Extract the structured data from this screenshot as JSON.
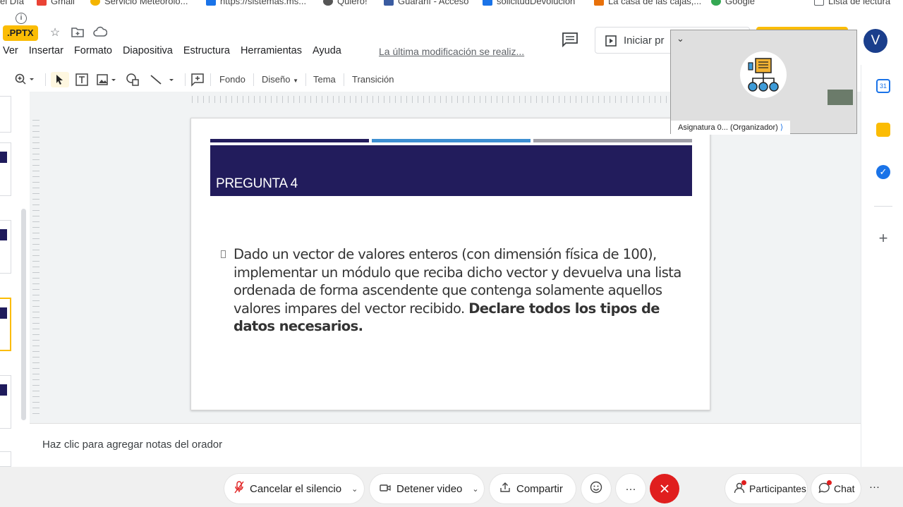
{
  "bookmarks": [
    {
      "label": "el Día",
      "color": "#ffffff"
    },
    {
      "label": "Gmail",
      "color": "#ea4335"
    },
    {
      "label": "Servicio Meteorolo...",
      "color": "#f4b400"
    },
    {
      "label": "https://sistemas.ms...",
      "color": "#1a73e8"
    },
    {
      "label": "Quiero!",
      "color": "#555555"
    },
    {
      "label": "Guaraní - Acceso",
      "color": "#3a5ba0"
    },
    {
      "label": "solicitudDevolucion",
      "color": "#1a73e8"
    },
    {
      "label": "La casa de las cajas,...",
      "color": "#e8710a"
    },
    {
      "label": "Google",
      "color": "#34a853"
    },
    {
      "label": "Lista de lectura",
      "color": "#5f6368"
    }
  ],
  "doc": {
    "file_badge": ".PPTX",
    "star_icon": "star-icon",
    "move_icon": "folder-move-icon",
    "cloud_icon": "cloud-status-icon",
    "last_edit": "La última modificación se realiz..."
  },
  "menu": [
    "Ver",
    "Insertar",
    "Formato",
    "Diapositiva",
    "Estructura",
    "Herramientas",
    "Ayuda"
  ],
  "header": {
    "present_label": "Iniciar pr",
    "avatar_initial": "V"
  },
  "toolbar": {
    "fondo": "Fondo",
    "diseno": "Diseño",
    "tema": "Tema",
    "transicion": "Transición"
  },
  "side_panel": {
    "calendar_badge": "31",
    "add_label": "+"
  },
  "slide": {
    "title": "PREGUNTA 4",
    "body_normal": "Dado un vector de valores enteros (con dimensión física de 100), implementar un módulo que reciba dicho vector y devuelva una lista ordenada de forma ascendente que contenga solamente aquellos valores impares del vector recibido. ",
    "body_bold": "Declare todos los tipos de datos necesarios.",
    "bar_colors": [
      "#221c5c",
      "#3d8fd1",
      "#a0a0a8"
    ]
  },
  "notes": {
    "placeholder": "Haz clic para agregar notas del orador"
  },
  "video_tile": {
    "label": "Asignatura 0... (Organizador)"
  },
  "meeting": {
    "unmute": "Cancelar el silencio",
    "stop_video": "Detener video",
    "share": "Compartir",
    "participants": "Participantes",
    "chat": "Chat",
    "more": "···"
  }
}
